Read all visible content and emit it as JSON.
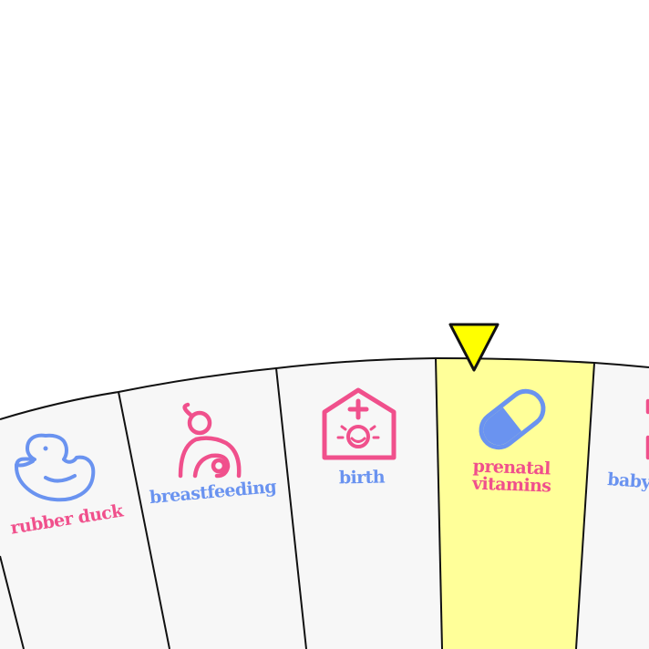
{
  "colors": {
    "pink": "#f0508c",
    "blue": "#6a93f0",
    "segment_fill": "#f7f7f7",
    "highlight_fill": "#ffff99",
    "pointer_fill": "#ffff00",
    "outline": "#111111"
  },
  "pointer": {
    "icon": "pointer-triangle-icon"
  },
  "selected_segment": "prenatal vitamins",
  "segments": [
    {
      "id": "rubber-duck",
      "label": "rubber duck",
      "icon": "rubber-duck-icon",
      "label_color": "#f0508c",
      "icon_color": "#6a93f0",
      "selected": false
    },
    {
      "id": "breastfeeding",
      "label": "breastfeeding",
      "icon": "breastfeeding-icon",
      "label_color": "#6a93f0",
      "icon_color": "#f0508c",
      "selected": false
    },
    {
      "id": "birth",
      "label": "birth",
      "icon": "hospital-birth-icon",
      "label_color": "#6a93f0",
      "icon_color": "#f0508c",
      "selected": false
    },
    {
      "id": "prenatal-vitamins",
      "label": "prenatal vitamins",
      "label_lines": [
        "prenatal",
        "vitamins"
      ],
      "icon": "pill-capsule-icon",
      "label_color": "#f0508c",
      "icon_color": "#6a93f0",
      "selected": true
    },
    {
      "id": "baby",
      "label": "baby",
      "icon": "baby-icon",
      "label_color": "#6a93f0",
      "icon_color": "#f0508c",
      "selected": false
    }
  ]
}
